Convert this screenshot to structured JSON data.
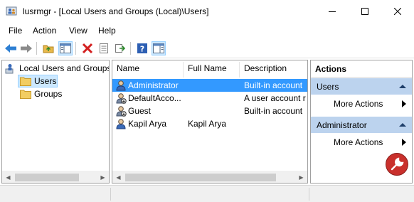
{
  "window": {
    "title": "lusrmgr - [Local Users and Groups (Local)\\Users]",
    "app_icon": "users-console-icon"
  },
  "menu": {
    "items": [
      "File",
      "Action",
      "View",
      "Help"
    ]
  },
  "toolbar": {
    "buttons": [
      "back-icon",
      "forward-icon",
      "up-folder-icon",
      "show-hide-tree-icon",
      "delete-icon",
      "properties-icon",
      "export-icon",
      "help-icon",
      "show-hide-action-pane-icon"
    ]
  },
  "tree": {
    "root_label": "Local Users and Groups",
    "children": [
      {
        "label": "Users",
        "selected": true
      },
      {
        "label": "Groups",
        "selected": false
      }
    ]
  },
  "list": {
    "columns": [
      "Name",
      "Full Name",
      "Description"
    ],
    "rows": [
      {
        "name": "Administrator",
        "full_name": "",
        "description": "Built-in account",
        "selected": true
      },
      {
        "name": "DefaultAcco...",
        "full_name": "",
        "description": "A user account r",
        "selected": false
      },
      {
        "name": "Guest",
        "full_name": "",
        "description": "Built-in account",
        "selected": false
      },
      {
        "name": "Kapil Arya",
        "full_name": "Kapil Arya",
        "description": "",
        "selected": false
      }
    ]
  },
  "actions": {
    "title": "Actions",
    "sections": [
      {
        "label": "Users",
        "items": [
          "More Actions"
        ]
      },
      {
        "label": "Administrator",
        "items": [
          "More Actions"
        ]
      }
    ]
  },
  "colors": {
    "selection": "#3399ff",
    "tree_selection": "#cce8ff",
    "action_section": "#bcd3ee"
  }
}
